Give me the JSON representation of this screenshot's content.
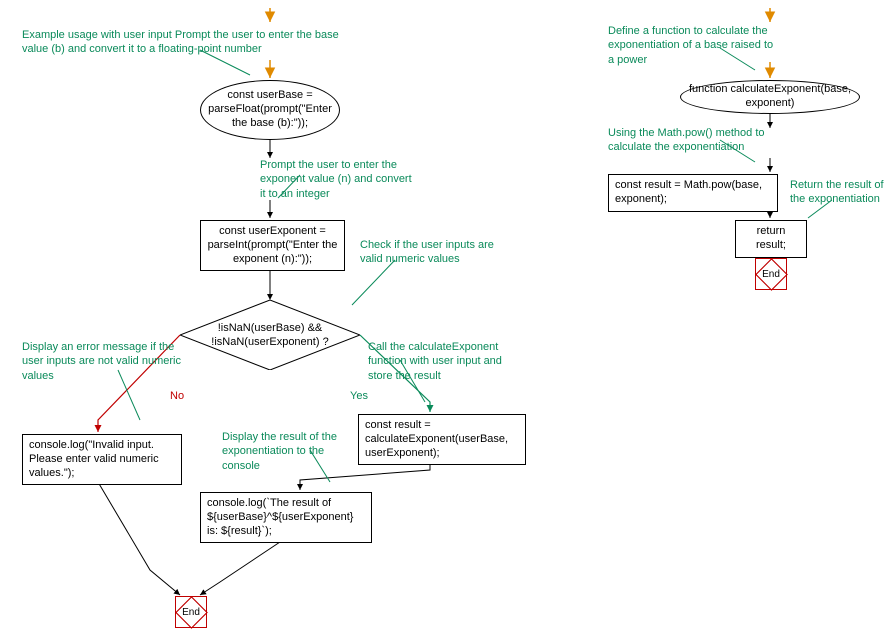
{
  "diagram": {
    "left": {
      "startArrowComment": "Example usage with user input\nPrompt the user to enter the base value (b) and convert it to a floating-point number",
      "userBase": "const userBase = parseFloat(prompt(\"Enter the base (b):\"));",
      "promptExpComment": "Prompt the user to enter the exponent value (n) and convert it to an integer",
      "userExponent": "const userExponent = parseInt(prompt(\"Enter the exponent (n):\"));",
      "checkComment": "Check if the user inputs are valid numeric values",
      "decision": "!isNaN(userBase) && !isNaN(userExponent) ?",
      "callComment": "Call the calculateExponent function with user input and store the result",
      "result": "const result = calculateExponent(userBase, userExponent);",
      "displayComment": "Display the result of the exponentiation to the console",
      "log": "console.log(`The result of ${userBase}^${userExponent} is: ${result}`);",
      "invalidComment": "Display an error message if the user inputs are not valid numeric values",
      "invalid": "console.log(\"Invalid input. Please enter valid numeric values.\");",
      "yes": "Yes",
      "no": "No",
      "end": "End"
    },
    "right": {
      "defineComment": "Define a function to calculate the exponentiation of a base raised to a power",
      "funcHeader": "function calculateExponent(base, exponent)",
      "mathComment": "Using the Math.pow() method to calculate the exponentiation",
      "mathPow": "const result = Math.pow(base, exponent);",
      "returnComment": "Return the result of the exponentiation",
      "return": "return result;",
      "end": "End"
    }
  }
}
